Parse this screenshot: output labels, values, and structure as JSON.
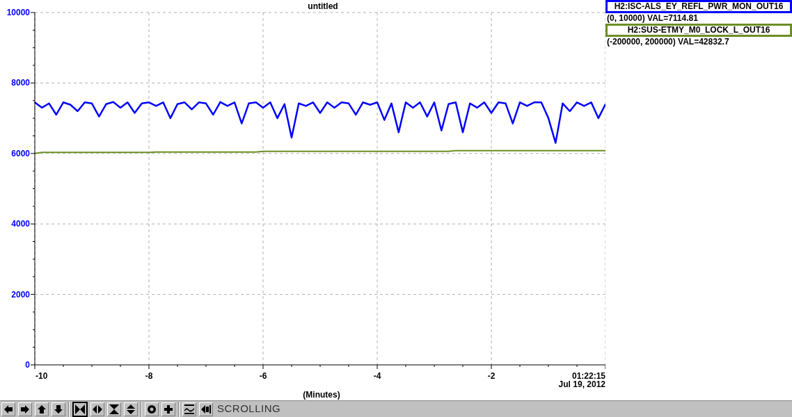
{
  "plot": {
    "end_time": "01:22:15",
    "date_label": "Jul 19, 2012",
    "chart_data": {
      "type": "line",
      "title": "untitled",
      "xlabel": "(Minutes)",
      "xlim": [
        -10,
        0
      ],
      "ylim": [
        0,
        10000
      ],
      "xticks": [
        -10,
        -8,
        -6,
        -4,
        -2
      ],
      "grid": true,
      "yticks": [
        0,
        2000,
        4000,
        6000,
        8000,
        10000
      ],
      "x": [
        -10,
        -9.875,
        -9.75,
        -9.625,
        -9.5,
        -9.375,
        -9.25,
        -9.125,
        -9,
        -8.875,
        -8.75,
        -8.625,
        -8.5,
        -8.375,
        -8.25,
        -8.125,
        -8,
        -7.875,
        -7.75,
        -7.625,
        -7.5,
        -7.375,
        -7.25,
        -7.125,
        -7,
        -6.875,
        -6.75,
        -6.625,
        -6.5,
        -6.375,
        -6.25,
        -6.125,
        -6,
        -5.875,
        -5.75,
        -5.625,
        -5.5,
        -5.375,
        -5.25,
        -5.125,
        -5,
        -4.875,
        -4.75,
        -4.625,
        -4.5,
        -4.375,
        -4.25,
        -4.125,
        -4,
        -3.875,
        -3.75,
        -3.625,
        -3.5,
        -3.375,
        -3.25,
        -3.125,
        -3,
        -2.875,
        -2.75,
        -2.625,
        -2.5,
        -2.375,
        -2.25,
        -2.125,
        -2,
        -1.875,
        -1.75,
        -1.625,
        -1.5,
        -1.375,
        -1.25,
        -1.125,
        -1,
        -0.875,
        -0.75,
        -0.625,
        -0.5,
        -0.375,
        -0.25,
        -0.125,
        0
      ],
      "series": [
        {
          "name": "H2:ISC-ALS_EY_REFL_PWR_MON_OUT16",
          "color": "#0000ff",
          "values": [
            7450,
            7300,
            7420,
            7100,
            7450,
            7380,
            7200,
            7450,
            7420,
            7050,
            7400,
            7460,
            7300,
            7450,
            7150,
            7420,
            7450,
            7350,
            7450,
            7000,
            7400,
            7450,
            7250,
            7450,
            7420,
            7100,
            7460,
            7350,
            7450,
            6850,
            7420,
            7450,
            7300,
            7450,
            7000,
            7400,
            6450,
            7420,
            7350,
            7450,
            7150,
            7450,
            7300,
            7450,
            7420,
            7100,
            7450,
            7380,
            7450,
            6950,
            7420,
            6600,
            7450,
            7300,
            7450,
            7050,
            7450,
            6650,
            7400,
            7450,
            6600,
            7420,
            7300,
            7450,
            7150,
            7450,
            7420,
            6850,
            7450,
            7350,
            7450,
            7450,
            7000,
            6300,
            7420,
            7200,
            7450,
            7350,
            7450,
            7000,
            7400
          ]
        },
        {
          "name": "H2:SUS-ETMY_M0_LOCK_L_OUT16",
          "color": "#6b8e23",
          "values": [
            6000,
            6030,
            6030,
            6030,
            6030,
            6030,
            6030,
            6030,
            6030,
            6030,
            6030,
            6030,
            6030,
            6030,
            6030,
            6030,
            6030,
            6040,
            6040,
            6040,
            6040,
            6040,
            6040,
            6040,
            6040,
            6040,
            6040,
            6040,
            6040,
            6040,
            6040,
            6040,
            6060,
            6060,
            6060,
            6060,
            6060,
            6060,
            6060,
            6060,
            6060,
            6060,
            6060,
            6060,
            6060,
            6060,
            6060,
            6060,
            6060,
            6060,
            6060,
            6060,
            6060,
            6060,
            6060,
            6060,
            6060,
            6060,
            6060,
            6080,
            6080,
            6080,
            6080,
            6080,
            6080,
            6080,
            6080,
            6080,
            6080,
            6080,
            6080,
            6080,
            6080,
            6080,
            6080,
            6080,
            6080,
            6080,
            6080,
            6080,
            6080
          ]
        }
      ]
    }
  },
  "legend": [
    {
      "reading": "(0, 10000) VAL=7114.81"
    },
    {
      "reading": "(-200000, 200000) VAL=42832.7"
    }
  ],
  "toolbar": {
    "buttons": [
      {
        "kind": "left",
        "selected": false
      },
      {
        "kind": "right",
        "selected": false
      },
      {
        "kind": "up",
        "selected": false
      },
      {
        "kind": "down",
        "selected": false
      },
      {
        "kind": "separator"
      },
      {
        "kind": "zoom-in-x",
        "selected": true
      },
      {
        "kind": "zoom-out-x",
        "selected": false
      },
      {
        "kind": "zoom-in-y",
        "selected": false
      },
      {
        "kind": "zoom-out-y",
        "selected": false
      },
      {
        "kind": "separator"
      },
      {
        "kind": "circle",
        "selected": false
      },
      {
        "kind": "plus",
        "selected": false
      },
      {
        "kind": "separator"
      },
      {
        "kind": "graph",
        "selected": false
      },
      {
        "kind": "back",
        "selected": false
      }
    ],
    "mode": "SCROLLING"
  }
}
